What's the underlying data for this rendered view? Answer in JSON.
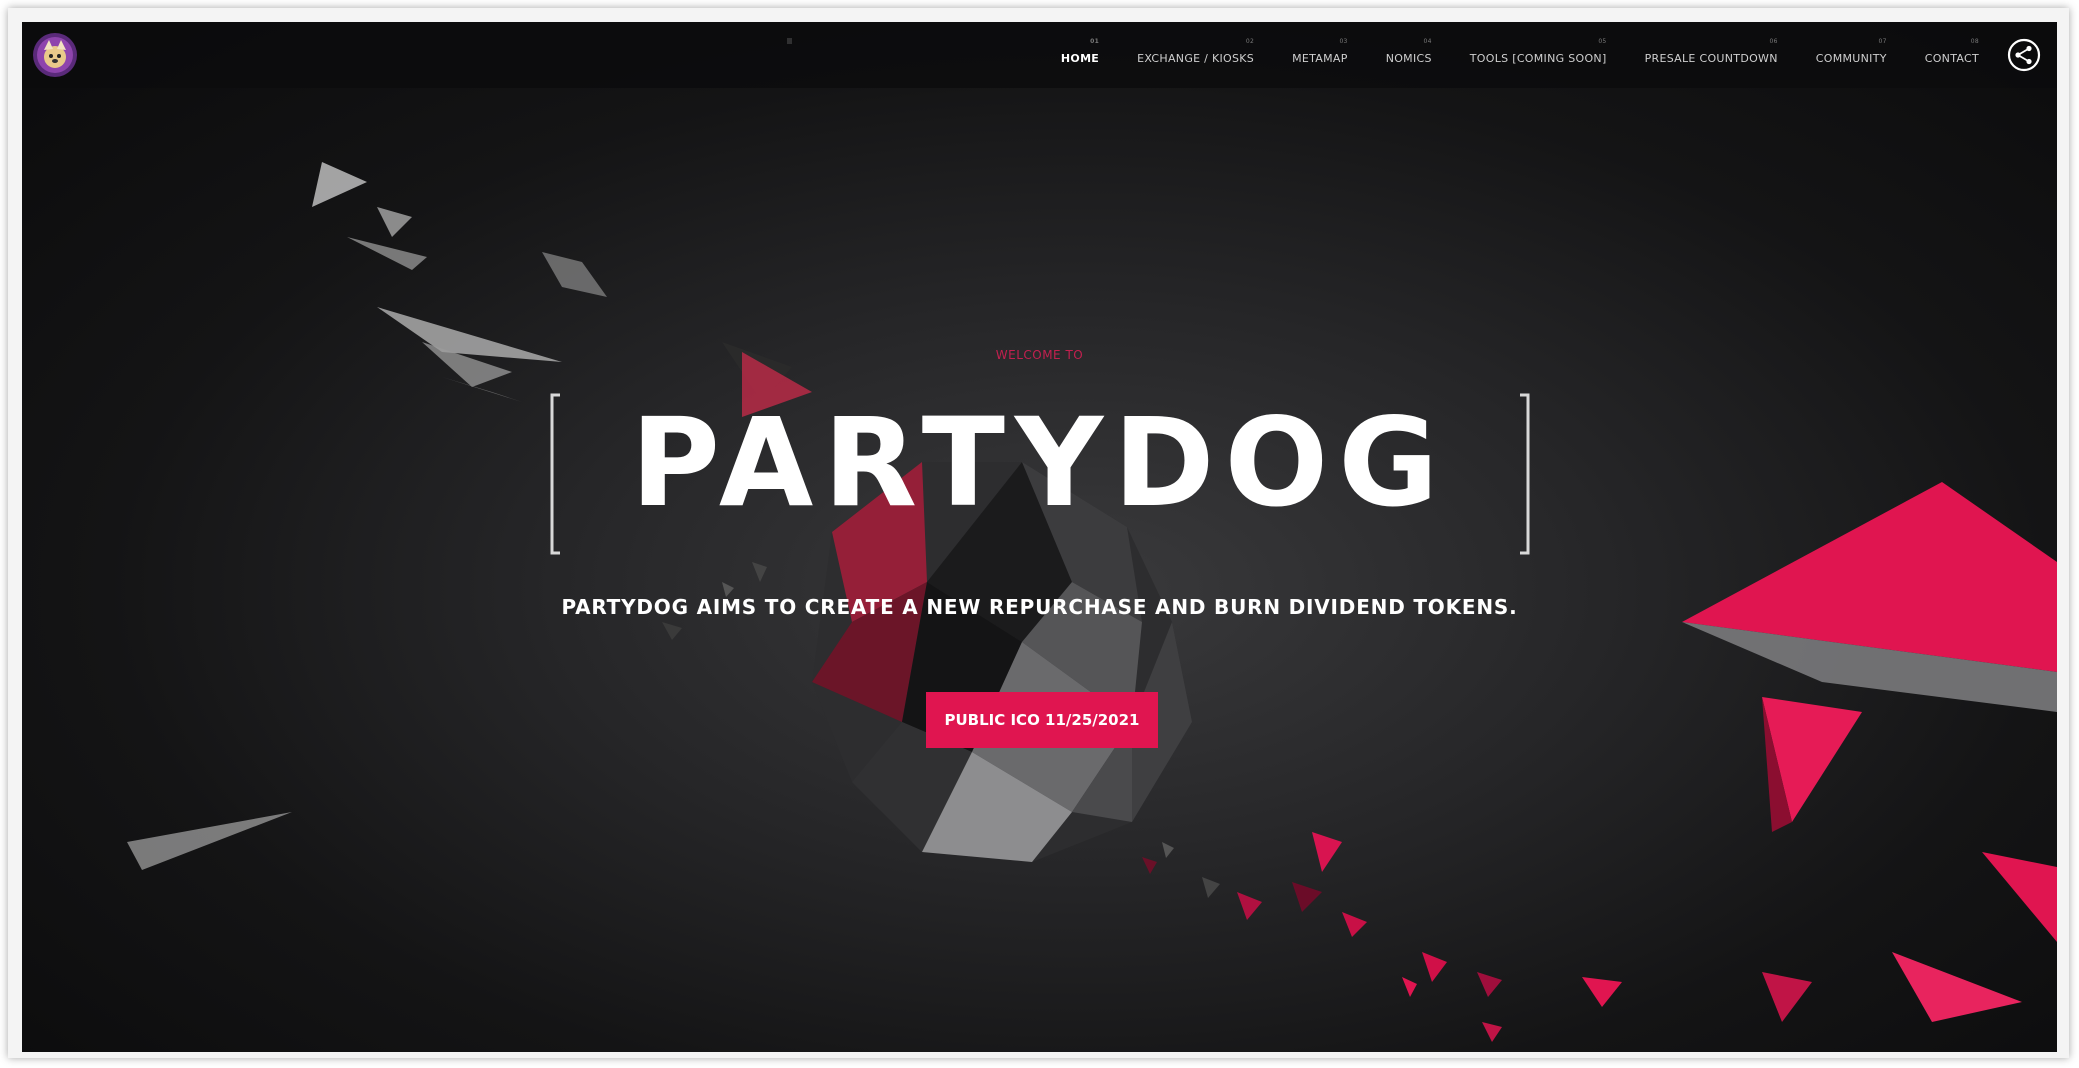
{
  "brand": {
    "logo_icon": "partydog-logo-icon"
  },
  "nav": {
    "items": [
      {
        "label": "HOME",
        "num": "01",
        "active": true
      },
      {
        "label": "EXCHANGE / KIOSKS",
        "num": "02"
      },
      {
        "label": "METAMAP",
        "num": "03"
      },
      {
        "label": "NOMICS",
        "num": "04"
      },
      {
        "label": "TOOLS [COMING SOON]",
        "num": "05"
      },
      {
        "label": "PRESALE COUNTDOWN",
        "num": "06"
      },
      {
        "label": "COMMUNITY",
        "num": "07"
      },
      {
        "label": "CONTACT",
        "num": "08"
      }
    ],
    "share_icon": "share-icon"
  },
  "hero": {
    "welcome": "WELCOME TO",
    "title": "PARTYDOG",
    "tagline": "PARTYDOG AIMS TO CREATE A NEW REPURCHASE AND BURN DIVIDEND TOKENS.",
    "cta_label": "PUBLIC ICO 11/25/2021"
  },
  "colors": {
    "accent": "#e01550",
    "background": "#1a1a1b",
    "welcome_text": "#c2204f"
  }
}
